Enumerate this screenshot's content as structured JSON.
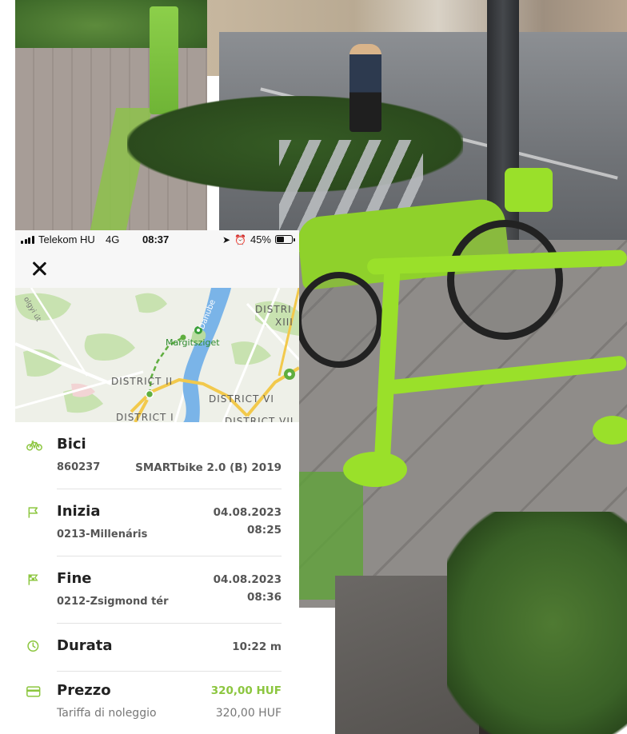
{
  "colors": {
    "accent": "#8cc63f",
    "text_primary": "#222222",
    "text_secondary": "#555555",
    "divider": "#e3e3e3",
    "map_water": "#7ab4e8",
    "map_road_yellow": "#f2c94c",
    "map_route": "#5fae3f"
  },
  "status_bar": {
    "carrier": "Telekom HU",
    "network": "4G",
    "time": "08:37",
    "battery": "45%",
    "battery_level": 0.45,
    "icons": [
      "signal-icon",
      "location-arrow-icon",
      "alarm-icon",
      "battery-icon"
    ]
  },
  "topbar": {
    "close_icon": "close-icon"
  },
  "map": {
    "labels": {
      "district_xiii_line1": "DISTRI",
      "district_xiii_line2": "XIII",
      "district_ii": "DISTRICT II",
      "district_vi": "DISTRICT VI",
      "district_i": "DISTRICT I",
      "district_vii": "DISTRICT VII",
      "island": "Margitsziget",
      "river": "Danube",
      "road": "olgyi út"
    }
  },
  "details": {
    "bike": {
      "icon": "bicycle-icon",
      "title": "Bici",
      "id": "860237",
      "model": "SMARTbike 2.0 (B) 2019"
    },
    "start": {
      "icon": "flag-icon",
      "title": "Inizia",
      "station": "0213-Millenáris",
      "date": "04.08.2023",
      "time": "08:25"
    },
    "end": {
      "icon": "checkered-flag-icon",
      "title": "Fine",
      "station": "0212-Zsigmond tér",
      "date": "04.08.2023",
      "time": "08:36"
    },
    "duration": {
      "icon": "clock-icon",
      "title": "Durata",
      "value": "10:22 m"
    },
    "price": {
      "icon": "card-icon",
      "title": "Prezzo",
      "total": "320,00 HUF",
      "fee_label": "Tariffa di noleggio",
      "fee_value": "320,00 HUF"
    }
  }
}
